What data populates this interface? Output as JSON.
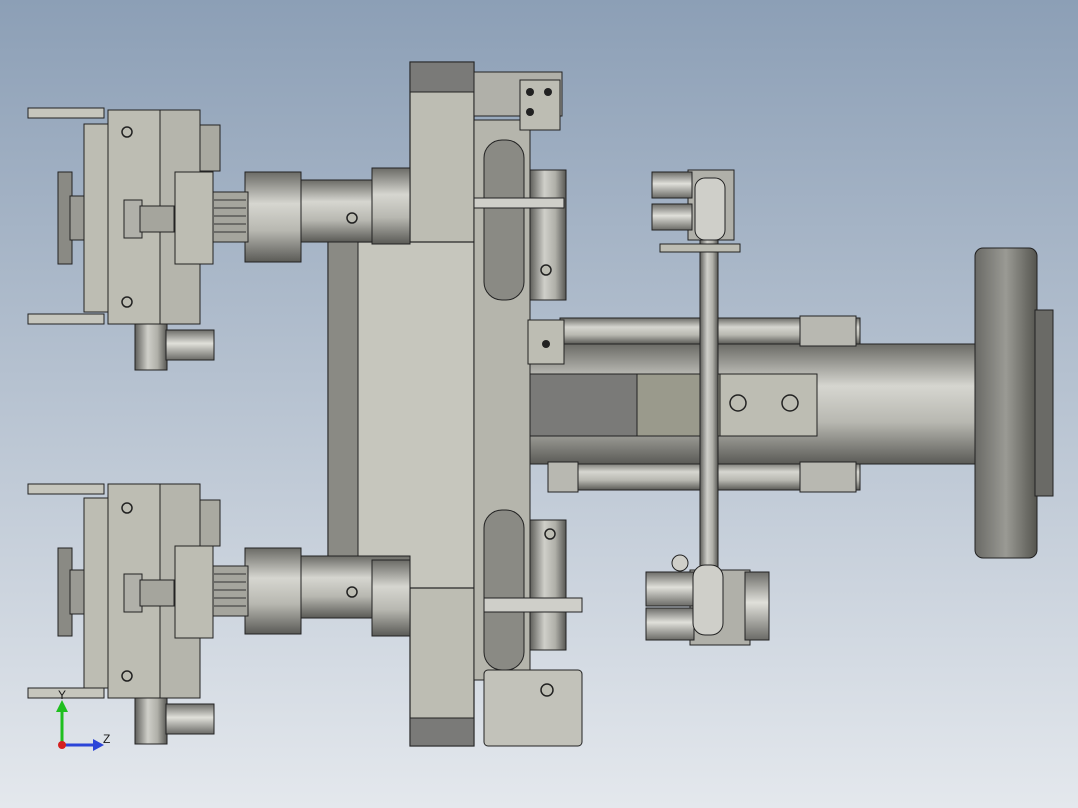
{
  "viewport": {
    "background_top": "#8c9fb6",
    "background_bottom": "#e4e8ed"
  },
  "triad": {
    "y_label": "Y",
    "z_label": "Z",
    "y_color": "#1fbf1f",
    "z_color": "#2b44d8",
    "origin_color": "#d42020"
  },
  "palette": {
    "body": "#bdbdb3",
    "body_dark": "#8f8f87",
    "edge": "#1a1a1a",
    "shaft_light": "#c6c6c0",
    "shaft_dark": "#5e5e5b",
    "accent_green": "#8a8a7a",
    "accent_blue_gray": "#7a7a80"
  }
}
